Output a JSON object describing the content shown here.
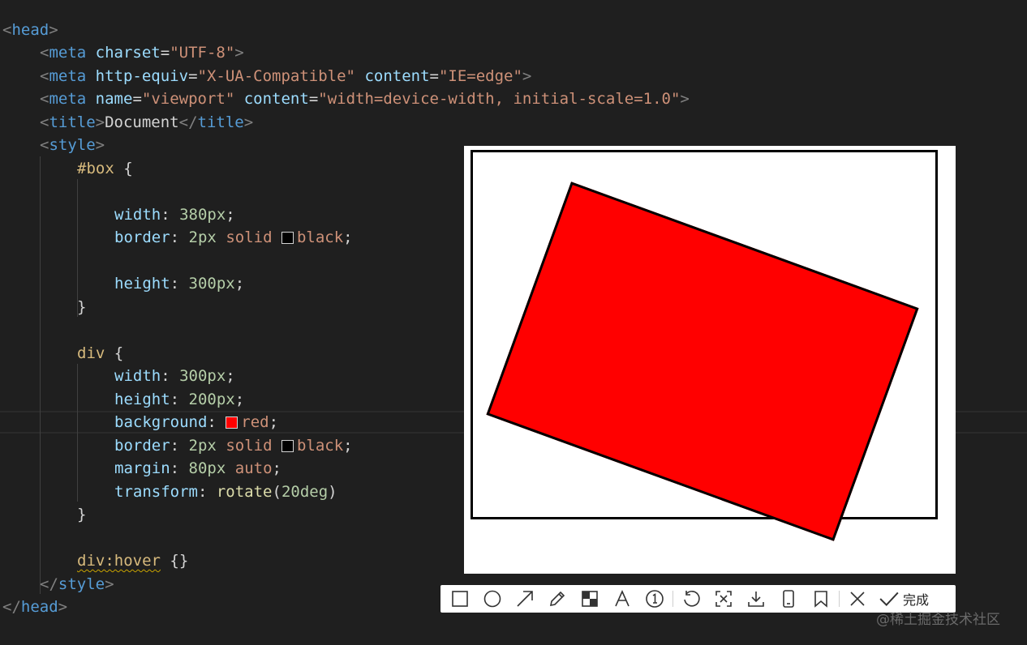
{
  "code": {
    "head_open": "head",
    "meta1": {
      "tag": "meta",
      "attr": "charset",
      "val": "\"UTF-8\""
    },
    "meta2": {
      "tag": "meta",
      "attr1": "http-equiv",
      "val1": "\"X-UA-Compatible\"",
      "attr2": "content",
      "val2": "\"IE=edge\""
    },
    "meta3": {
      "tag": "meta",
      "attr1": "name",
      "val1": "\"viewport\"",
      "attr2": "content",
      "val2": "\"width=device-width, initial-scale=1.0\""
    },
    "title": {
      "tag": "title",
      "text": "Document"
    },
    "style_tag": "style",
    "box_selector": "#box",
    "box_rules": [
      {
        "prop": "width",
        "num": "380px",
        "rest": ""
      },
      {
        "prop": "border",
        "num": "2px",
        "rest": "solid",
        "color": "black",
        "swatch": "#000000"
      },
      {
        "prop": "height",
        "num": "300px",
        "rest": ""
      }
    ],
    "div_selector": "div",
    "div_rules": [
      {
        "prop": "width",
        "num": "300px"
      },
      {
        "prop": "height",
        "num": "200px"
      },
      {
        "prop": "background",
        "color": "red",
        "swatch": "#ff0000"
      },
      {
        "prop": "border",
        "num": "2px",
        "rest": "solid",
        "color": "black",
        "swatch": "#000000"
      },
      {
        "prop": "margin",
        "num": "80px",
        "rest": "auto"
      },
      {
        "prop": "transform",
        "fn": "rotate",
        "arg": "20deg"
      }
    ],
    "hover_selector": "div:hover",
    "hover_braces": "{}",
    "style_close": "style",
    "head_close": "head"
  },
  "toolbar": {
    "tools": [
      "rectangle-icon",
      "circle-icon",
      "arrow-icon",
      "pencil-icon",
      "mosaic-icon",
      "text-icon",
      "number-icon",
      "undo-icon",
      "crop-icon",
      "download-icon",
      "phone-icon",
      "pin-icon",
      "close-icon",
      "check-icon"
    ],
    "done_label": "完成"
  },
  "watermark": "@稀土掘金技术社区",
  "colors": {
    "red": "#ff0000",
    "editor_bg": "#1f1f1f"
  }
}
